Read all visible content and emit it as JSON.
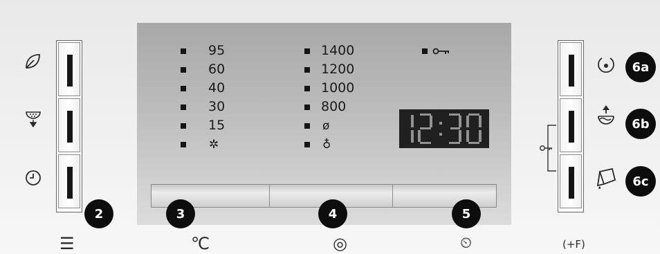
{
  "temperatures": [
    "95",
    "60",
    "40",
    "30",
    "15",
    "✲"
  ],
  "spin_speeds": [
    "1400",
    "1200",
    "1000",
    "800",
    "ø",
    "♁"
  ],
  "lock_icon": "key-icon",
  "time_display": "12:30",
  "badges": {
    "left_buttons": "2",
    "touch_left": "3",
    "touch_middle": "4",
    "touch_right": "5",
    "right_top": "6a",
    "right_middle": "6b",
    "right_bottom": "6c"
  },
  "left_icons": [
    "leaf-icon",
    "prewash-icon",
    "clock-icon"
  ],
  "right_icons": [
    "rinse-drop-icon",
    "extra-rinse-icon",
    "pour-icon"
  ],
  "bottom_icons": {
    "list": "☰",
    "temperature": "℃",
    "spin": "◎",
    "timer": "⏲",
    "option": "(+F)"
  }
}
